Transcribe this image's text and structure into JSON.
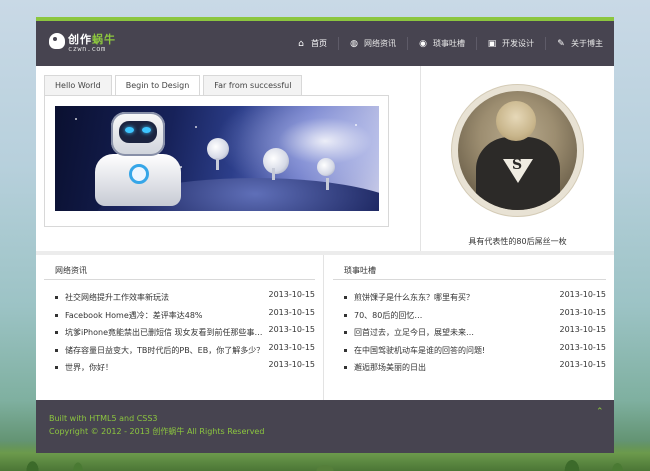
{
  "logo": {
    "cn_main": "创作",
    "cn_accent": "蜗牛",
    "en": "czwn.com"
  },
  "nav": [
    {
      "label": "首页",
      "icon": "home-icon",
      "glyph": "⌂"
    },
    {
      "label": "网络资讯",
      "icon": "globe-icon",
      "glyph": "◍"
    },
    {
      "label": "琐事吐槽",
      "icon": "chat-icon",
      "glyph": "◉"
    },
    {
      "label": "开发设计",
      "icon": "html5-icon",
      "glyph": "▣"
    },
    {
      "label": "关于博主",
      "icon": "pen-icon",
      "glyph": "✎"
    }
  ],
  "tabs": [
    "Hello World",
    "Begin to Design",
    "Far from successful"
  ],
  "profile": {
    "caption": "具有代表性的80后屌丝一枚"
  },
  "left_column": {
    "title": "网络资讯",
    "items": [
      {
        "title": "社交网络提升工作效率新玩法",
        "date": "2013-10-15"
      },
      {
        "title": "Facebook Home遇冷：差评率达48%",
        "date": "2013-10-15"
      },
      {
        "title": "坑爹iPhone竟能禁出已删短信 现女友看到前任那些事…",
        "date": "2013-10-15"
      },
      {
        "title": "储存容量日益变大，TB时代后的PB、EB，你了解多少？",
        "date": "2013-10-15"
      },
      {
        "title": "世界，你好！",
        "date": "2013-10-15"
      }
    ]
  },
  "right_column": {
    "title": "琐事吐槽",
    "items": [
      {
        "title": "煎饼馃子是什么东东？哪里有买？",
        "date": "2013-10-15"
      },
      {
        "title": "70、80后的回忆…",
        "date": "2013-10-15"
      },
      {
        "title": "回首过去，立足今日，展望未来…",
        "date": "2013-10-15"
      },
      {
        "title": "在中国驾驶机动车是谁的回答的问题!",
        "date": "2013-10-15"
      },
      {
        "title": "邂逅那场美丽的日出",
        "date": "2013-10-15"
      }
    ]
  },
  "footer": {
    "line1": "Built with HTML5 and CSS3",
    "line2": "Copyright © 2012 - 2013 创作蜗牛 All Rights Reserved",
    "up_glyph": "⌃"
  },
  "colors": {
    "accent": "#8cc63f",
    "header_bg": "#474450"
  }
}
